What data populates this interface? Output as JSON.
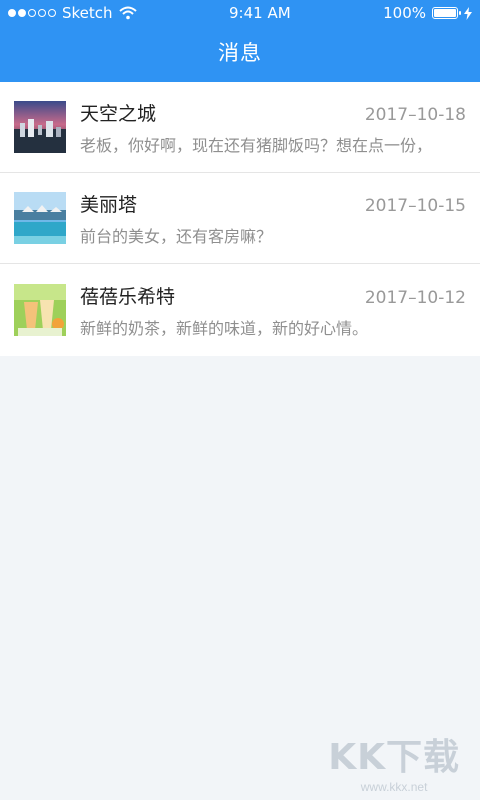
{
  "status_bar": {
    "carrier": "Sketch",
    "time": "9:41 AM",
    "battery": "100%"
  },
  "header": {
    "title": "消息"
  },
  "messages": [
    {
      "name": "天空之城",
      "date": "2017–10-18",
      "preview": "老板，你好啊，现在还有猪脚饭吗？想在点一份，",
      "thumb": "city-sunset-thumbnail"
    },
    {
      "name": "美丽塔",
      "date": "2017–10-15",
      "preview": "前台的美女，还有客房嘛？",
      "thumb": "resort-pool-thumbnail"
    },
    {
      "name": "蓓蓓乐希特",
      "date": "2017–10-12",
      "preview": "新鲜的奶茶，新鲜的味道，新的好心情。",
      "thumb": "milk-tea-thumbnail"
    }
  ],
  "watermark": {
    "main": "KK下载",
    "sub": "www.kkx.net"
  },
  "colors": {
    "accent": "#2f93f3",
    "background": "#f2f5f8"
  }
}
